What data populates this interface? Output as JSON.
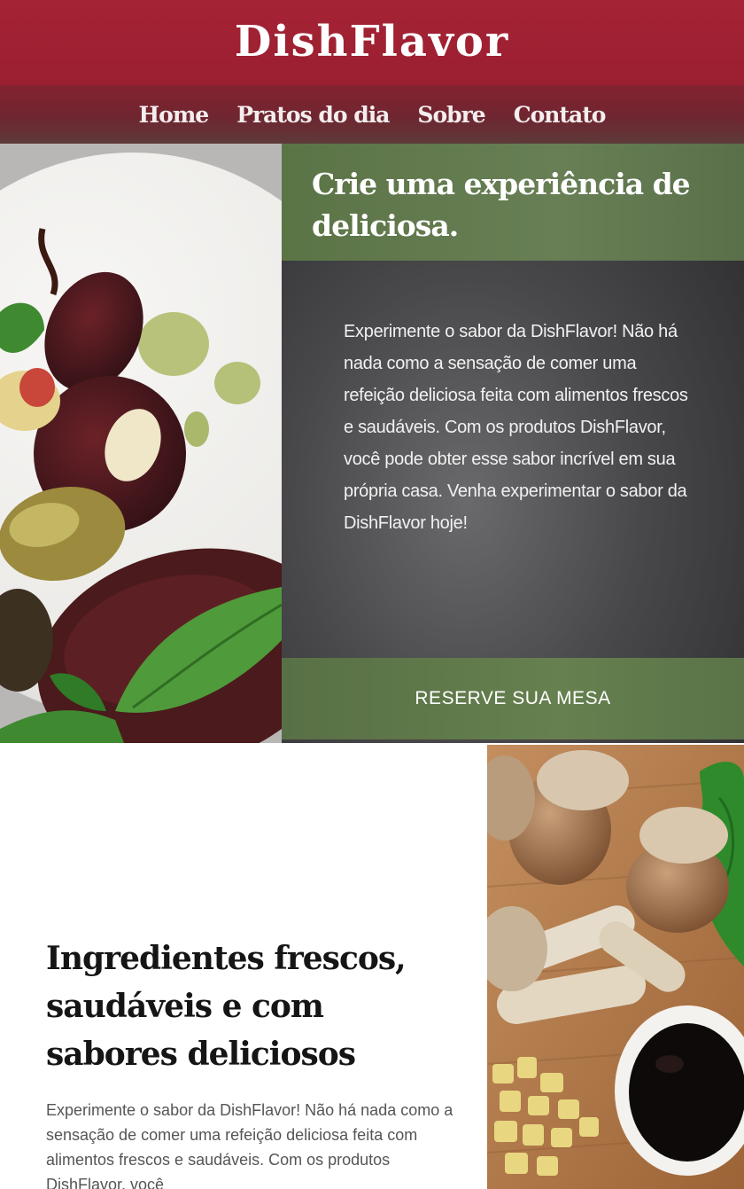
{
  "header": {
    "brand": "DishFlavor"
  },
  "nav": {
    "items": [
      {
        "label": "Home"
      },
      {
        "label": "Pratos do dia"
      },
      {
        "label": "Sobre"
      },
      {
        "label": "Contato"
      }
    ]
  },
  "hero": {
    "title": "Crie uma experiência de deliciosa.",
    "text": "Experimente o sabor da DishFlavor! Não há nada como a sensação de comer uma refeição deliciosa feita com alimentos frescos e saudáveis. Com os produtos DishFlavor, você pode obter esse sabor incrível em sua própria casa. Venha experimentar o sabor da DishFlavor hoje!",
    "cta_label": "RESERVE SUA MESA"
  },
  "section": {
    "title": "Ingredientes frescos, saudáveis e com sabores deliciosos",
    "text": "Experimente o sabor da DishFlavor! Não há nada como a sensação de comer uma refeição deliciosa feita com alimentos frescos e saudáveis. Com os produtos DishFlavor, você"
  },
  "colors": {
    "brand_red": "#a52335",
    "nav_dark": "#6f2630",
    "accent_green": "#62794f",
    "hero_dark": "#48484b"
  }
}
